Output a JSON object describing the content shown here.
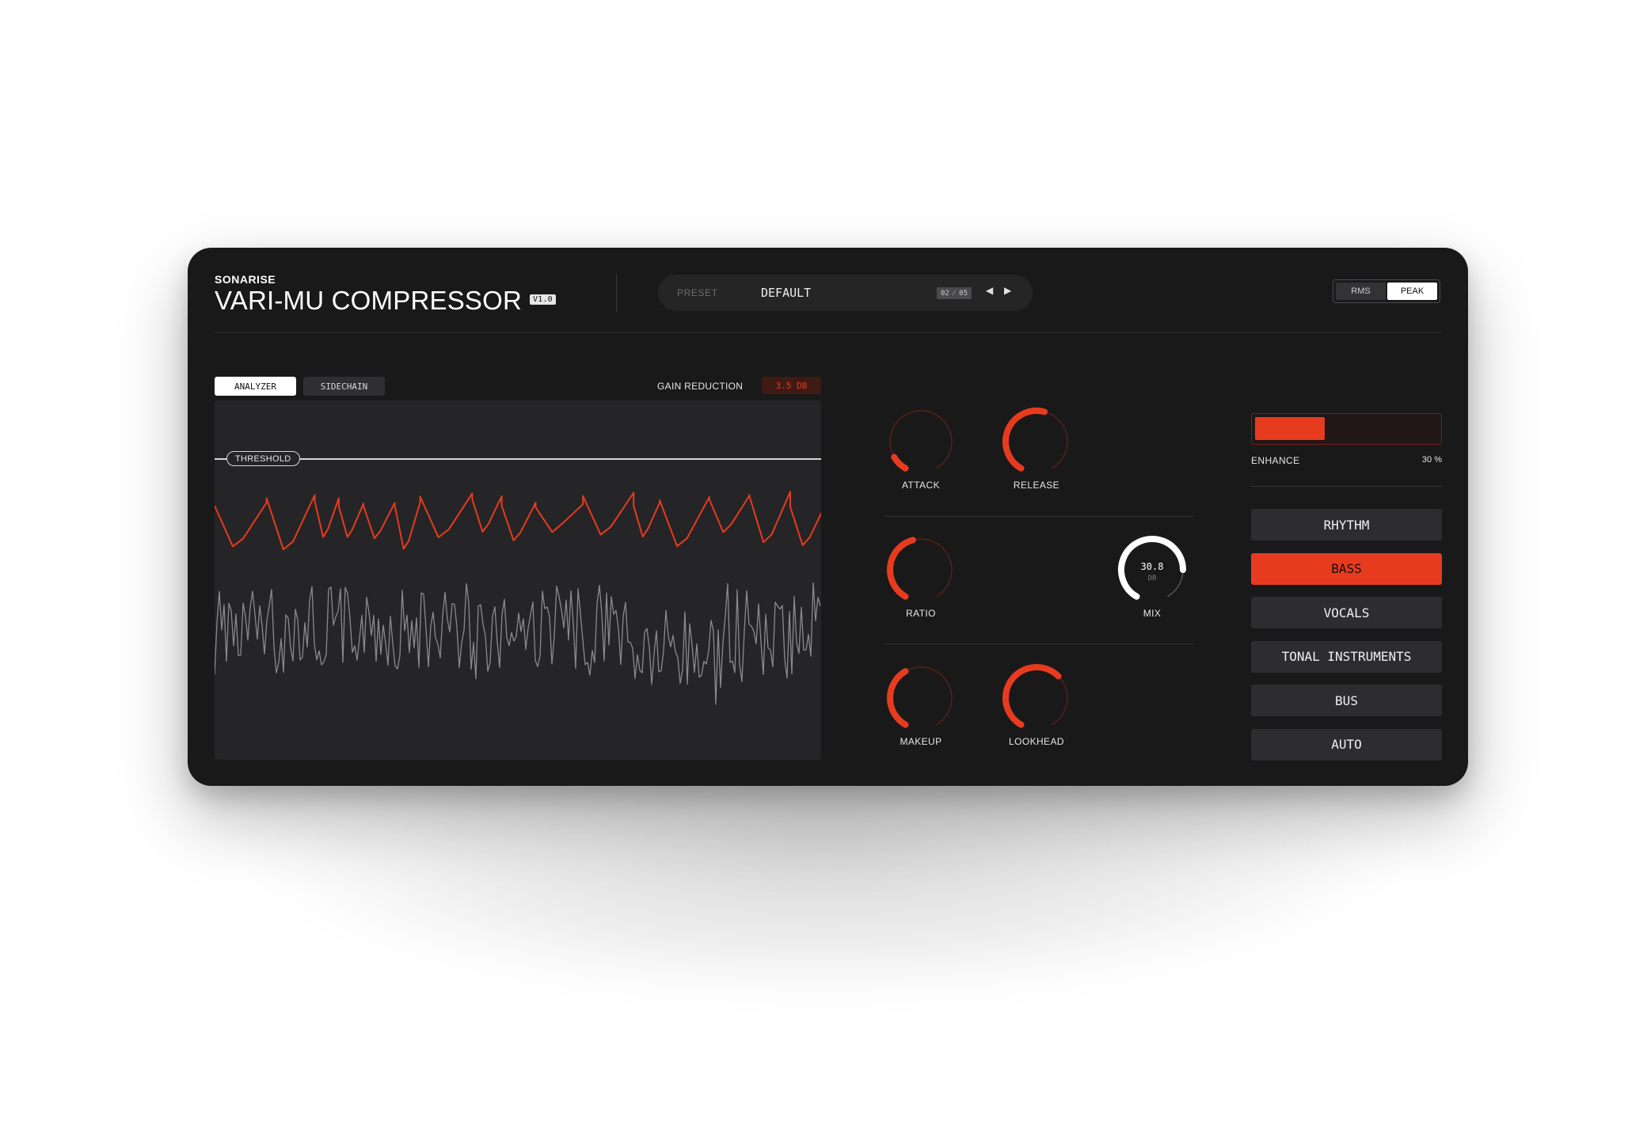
{
  "colors": {
    "accent": "#e63b1f",
    "panel": "#19191a",
    "analyzer_bg": "#252527",
    "text": "#e8e8e8"
  },
  "header": {
    "brand": "SONARISE",
    "title": "VARI-MU COMPRESSOR",
    "version": "V1.0"
  },
  "preset": {
    "label": "PRESET",
    "name": "DEFAULT",
    "counter": "02 ⁄ 05",
    "prev_icon": "◀",
    "next_icon": "▶"
  },
  "meter_mode": {
    "options": [
      "RMS",
      "PEAK"
    ],
    "selected": "PEAK"
  },
  "analyzer": {
    "tabs": [
      "ANALYZER",
      "SIDECHAIN"
    ],
    "selected_tab": "ANALYZER",
    "gain_reduction_label": "GAIN REDUCTION",
    "gain_reduction_value": "3.5 DB",
    "threshold_label": "THRESHOLD"
  },
  "knobs": {
    "attack": {
      "label": "ATTACK",
      "level": 0.1
    },
    "release": {
      "label": "RELEASE",
      "level": 0.55
    },
    "ratio": {
      "label": "RATIO",
      "level": 0.45
    },
    "mix": {
      "label": "MIX",
      "value": "30.8",
      "unit": "DB",
      "level": 0.8
    },
    "makeup": {
      "label": "MAKEUP",
      "level": 0.4
    },
    "lookhead": {
      "label": "LOOKHEAD",
      "level": 0.65
    }
  },
  "enhance": {
    "label": "ENHANCE",
    "value": "30 %",
    "level": 0.38
  },
  "modes": {
    "items": [
      "RHYTHM",
      "BASS",
      "VOCALS",
      "TONAL INSTRUMENTS",
      "BUS",
      "AUTO"
    ],
    "selected": "BASS"
  }
}
